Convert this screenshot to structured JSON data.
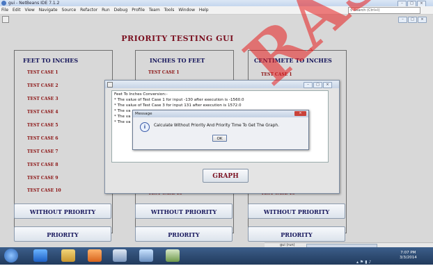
{
  "ide": {
    "title": "gui - NetBeans IDE 7.1.2",
    "menu": [
      "File",
      "Edit",
      "View",
      "Navigate",
      "Source",
      "Refactor",
      "Run",
      "Debug",
      "Profile",
      "Team",
      "Tools",
      "Window",
      "Help"
    ],
    "search_placeholder": "Search (Ctrl+I)"
  },
  "app": {
    "heading": "PRIORITY TESTING GUI",
    "columns": [
      {
        "title": "FEET TO INCHES",
        "cases": [
          "TEST CASE 1",
          "TEST CASE 2",
          "TEST CASE 3",
          "TEST CASE 4",
          "TEST CASE 5",
          "TEST CASE 6",
          "TEST CASE 7",
          "TEST CASE 8",
          "TEST CASE 9",
          "TEST CASE 10"
        ]
      },
      {
        "title": "INCHES TO FEET",
        "cases": [
          "TEST CASE 1",
          "TEST CASE 10"
        ]
      },
      {
        "title": "CENTIMETE TO INCHES",
        "cases": [
          "TEST CASE 1",
          "TEST CASE 10"
        ]
      }
    ],
    "without_priority_label": "WITHOUT PRIORITY",
    "priority_label": "PRIORITY"
  },
  "results_window": {
    "lines": [
      "Feet To Inches Conversion:-",
      " * The value of Test Case 1 for input -130 after execution is -1560.0",
      " * The value of Test Case 3 for input 131 after execution is 1572.0",
      " * The va",
      " * The va",
      " * The va"
    ],
    "graph_button": "GRAPH"
  },
  "message_dialog": {
    "title": "Message",
    "icon": "info-icon",
    "text": "Calculate Without Priority And Priority Time To Get The Graph.",
    "ok_label": "OK"
  },
  "bottom_strip": {
    "text": "gui (run)"
  },
  "taskbar": {
    "time": "7:07 PM",
    "date": "3/3/2014"
  },
  "watermark": {
    "text": "RASET:"
  },
  "colors": {
    "heading": "#7a1020",
    "column_title": "#14145a",
    "test_case": "#8a1010",
    "watermark": "#e81e1e"
  }
}
